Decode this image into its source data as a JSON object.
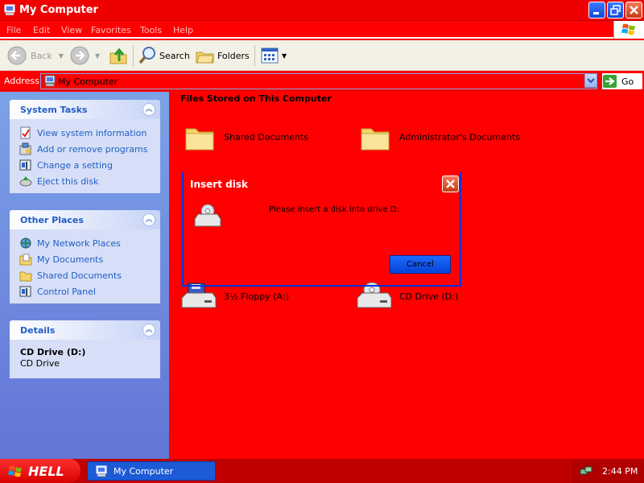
{
  "window": {
    "title": "My Computer",
    "controls": {
      "minimize": "_",
      "maximize": "□",
      "close": "✕"
    }
  },
  "menu": [
    "File",
    "Edit",
    "View",
    "Favorites",
    "Tools",
    "Help"
  ],
  "toolbar": {
    "back_label": "Back",
    "search_label": "Search",
    "folders_label": "Folders"
  },
  "address": {
    "label": "Address",
    "value": "My Computer",
    "go_label": "Go"
  },
  "sidebar": {
    "system_tasks": {
      "title": "System Tasks",
      "items": [
        {
          "label": "View system information",
          "icon": "system-info-icon"
        },
        {
          "label": "Add or remove programs",
          "icon": "add-remove-programs-icon"
        },
        {
          "label": "Change a setting",
          "icon": "control-panel-icon"
        },
        {
          "label": "Eject this disk",
          "icon": "eject-disk-icon"
        }
      ]
    },
    "other_places": {
      "title": "Other Places",
      "items": [
        {
          "label": "My Network Places",
          "icon": "network-places-icon"
        },
        {
          "label": "My Documents",
          "icon": "documents-folder-icon"
        },
        {
          "label": "Shared Documents",
          "icon": "shared-folder-icon"
        },
        {
          "label": "Control Panel",
          "icon": "control-panel-icon"
        }
      ]
    },
    "details": {
      "title": "Details",
      "name": "CD Drive (D:)",
      "type": "CD Drive"
    }
  },
  "main": {
    "group_title": "Files Stored on This Computer",
    "items": [
      {
        "label": "Shared Documents",
        "icon": "folder-icon"
      },
      {
        "label": "Administrator's Documents",
        "icon": "folder-icon"
      },
      {
        "label": "3½ Floppy (A:)",
        "icon": "floppy-drive-icon"
      },
      {
        "label": "CD Drive (D:)",
        "icon": "cd-drive-icon"
      }
    ]
  },
  "dialog": {
    "title": "Insert disk",
    "message": "Please insert a disk into drive D:",
    "cancel_label": "Cancel"
  },
  "taskbar": {
    "start_label": "HELL",
    "task_label": "My Computer",
    "clock": "2:44 PM"
  },
  "colors": {
    "background": "#ff0000",
    "taskbar": "#bf0000",
    "link": "#215dc6",
    "dialog_border": "#0831d9"
  }
}
